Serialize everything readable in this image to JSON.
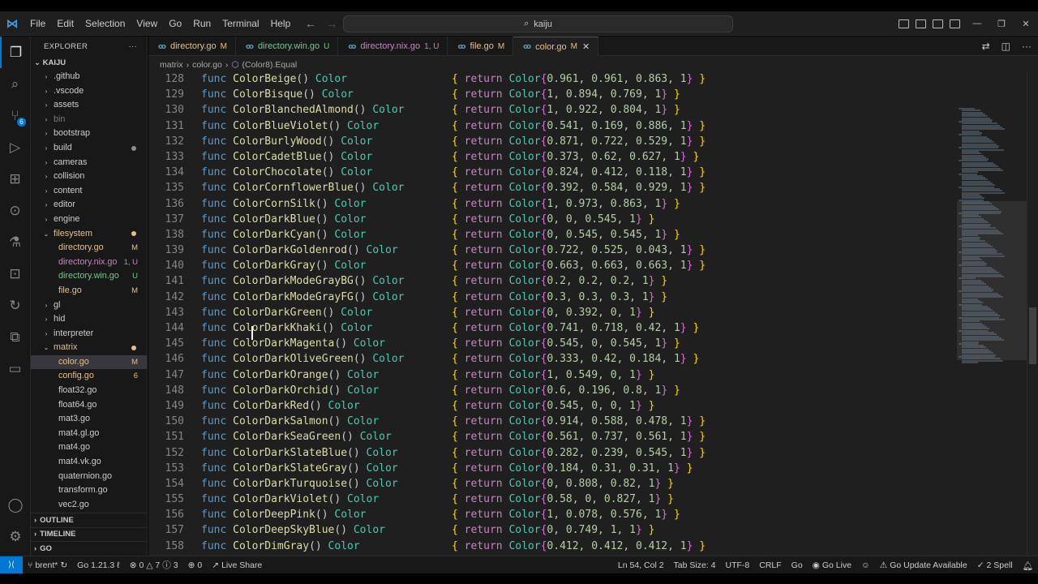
{
  "menu": [
    "File",
    "Edit",
    "Selection",
    "View",
    "Go",
    "Run",
    "Terminal",
    "Help"
  ],
  "search": {
    "text": "kaiju"
  },
  "activity_badge": "6",
  "explorer": {
    "title": "EXPLORER",
    "root": "KAIJU",
    "items": [
      {
        "label": ".github",
        "type": "folder",
        "level": 0,
        "open": false
      },
      {
        "label": ".vscode",
        "type": "folder",
        "level": 0,
        "open": false
      },
      {
        "label": "assets",
        "type": "folder",
        "level": 0,
        "open": false
      },
      {
        "label": "bin",
        "type": "folder",
        "level": 0,
        "open": false,
        "dim": true
      },
      {
        "label": "bootstrap",
        "type": "folder",
        "level": 0,
        "open": false
      },
      {
        "label": "build",
        "type": "folder",
        "level": 0,
        "open": false,
        "dot": "#8c8c8c"
      },
      {
        "label": "cameras",
        "type": "folder",
        "level": 0,
        "open": false
      },
      {
        "label": "collision",
        "type": "folder",
        "level": 0,
        "open": false
      },
      {
        "label": "content",
        "type": "folder",
        "level": 0,
        "open": false
      },
      {
        "label": "editor",
        "type": "folder",
        "level": 0,
        "open": false
      },
      {
        "label": "engine",
        "type": "folder",
        "level": 0,
        "open": false
      },
      {
        "label": "filesystem",
        "type": "folder",
        "level": 0,
        "open": true,
        "color": "#e2c08d",
        "dot": "#e2c08d"
      },
      {
        "label": "directory.go",
        "type": "file",
        "level": 1,
        "color": "#e2c08d",
        "badge": "M"
      },
      {
        "label": "directory.nix.go",
        "type": "file",
        "level": 1,
        "color": "#c586c0",
        "badge": "1, U"
      },
      {
        "label": "directory.win.go",
        "type": "file",
        "level": 1,
        "color": "#73c991",
        "badge": "U"
      },
      {
        "label": "file.go",
        "type": "file",
        "level": 1,
        "color": "#e2c08d",
        "badge": "M"
      },
      {
        "label": "gl",
        "type": "folder",
        "level": 0,
        "open": false
      },
      {
        "label": "hid",
        "type": "folder",
        "level": 0,
        "open": false
      },
      {
        "label": "interpreter",
        "type": "folder",
        "level": 0,
        "open": false
      },
      {
        "label": "matrix",
        "type": "folder",
        "level": 0,
        "open": true,
        "color": "#e2c08d",
        "dot": "#e2c08d"
      },
      {
        "label": "color.go",
        "type": "file",
        "level": 1,
        "color": "#e2c08d",
        "badge": "M",
        "selected": true
      },
      {
        "label": "config.go",
        "type": "file",
        "level": 1,
        "color": "#e2c08d",
        "badge": "6"
      },
      {
        "label": "float32.go",
        "type": "file",
        "level": 1
      },
      {
        "label": "float64.go",
        "type": "file",
        "level": 1
      },
      {
        "label": "mat3.go",
        "type": "file",
        "level": 1
      },
      {
        "label": "mat4.gl.go",
        "type": "file",
        "level": 1
      },
      {
        "label": "mat4.go",
        "type": "file",
        "level": 1
      },
      {
        "label": "mat4.vk.go",
        "type": "file",
        "level": 1
      },
      {
        "label": "quaternion.go",
        "type": "file",
        "level": 1
      },
      {
        "label": "transform.go",
        "type": "file",
        "level": 1
      },
      {
        "label": "vec2.go",
        "type": "file",
        "level": 1
      }
    ],
    "sections": [
      "OUTLINE",
      "TIMELINE",
      "GO"
    ]
  },
  "tabs": [
    {
      "label": "directory.go",
      "badge": "M",
      "color": "#e2c08d"
    },
    {
      "label": "directory.win.go",
      "badge": "U",
      "color": "#73c991"
    },
    {
      "label": "directory.nix.go",
      "badge": "1, U",
      "color": "#c586c0"
    },
    {
      "label": "file.go",
      "badge": "M",
      "color": "#e2c08d"
    },
    {
      "label": "color.go",
      "badge": "M",
      "color": "#e2c08d",
      "active": true
    }
  ],
  "breadcrumb": [
    "matrix",
    "color.go",
    "(Color8).Equal"
  ],
  "code_lines": [
    {
      "n": "128",
      "name": "ColorBeige",
      "vals": "0.961, 0.961, 0.863, 1"
    },
    {
      "n": "129",
      "name": "ColorBisque",
      "vals": "1, 0.894, 0.769, 1"
    },
    {
      "n": "130",
      "name": "ColorBlanchedAlmond",
      "vals": "1, 0.922, 0.804, 1"
    },
    {
      "n": "131",
      "name": "ColorBlueViolet",
      "vals": "0.541, 0.169, 0.886, 1"
    },
    {
      "n": "132",
      "name": "ColorBurlyWood",
      "vals": "0.871, 0.722, 0.529, 1"
    },
    {
      "n": "133",
      "name": "ColorCadetBlue",
      "vals": "0.373, 0.62, 0.627, 1"
    },
    {
      "n": "134",
      "name": "ColorChocolate",
      "vals": "0.824, 0.412, 0.118, 1"
    },
    {
      "n": "135",
      "name": "ColorCornflowerBlue",
      "vals": "0.392, 0.584, 0.929, 1"
    },
    {
      "n": "136",
      "name": "ColorCornSilk",
      "vals": "1, 0.973, 0.863, 1"
    },
    {
      "n": "137",
      "name": "ColorDarkBlue",
      "vals": "0, 0, 0.545, 1"
    },
    {
      "n": "138",
      "name": "ColorDarkCyan",
      "vals": "0, 0.545, 0.545, 1"
    },
    {
      "n": "139",
      "name": "ColorDarkGoldenrod",
      "vals": "0.722, 0.525, 0.043, 1"
    },
    {
      "n": "140",
      "name": "ColorDarkGray",
      "vals": "0.663, 0.663, 0.663, 1"
    },
    {
      "n": "141",
      "name": "ColorDarkModeGrayBG",
      "vals": "0.2, 0.2, 0.2, 1"
    },
    {
      "n": "142",
      "name": "ColorDarkModeGrayFG",
      "vals": "0.3, 0.3, 0.3, 1"
    },
    {
      "n": "143",
      "name": "ColorDarkGreen",
      "vals": "0, 0.392, 0, 1"
    },
    {
      "n": "144",
      "name": "ColorDarkKhaki",
      "vals": "0.741, 0.718, 0.42, 1"
    },
    {
      "n": "145",
      "name": "ColorDarkMagenta",
      "vals": "0.545, 0, 0.545, 1"
    },
    {
      "n": "146",
      "name": "ColorDarkOliveGreen",
      "vals": "0.333, 0.42, 0.184, 1"
    },
    {
      "n": "147",
      "name": "ColorDarkOrange",
      "vals": "1, 0.549, 0, 1"
    },
    {
      "n": "148",
      "name": "ColorDarkOrchid",
      "vals": "0.6, 0.196, 0.8, 1"
    },
    {
      "n": "149",
      "name": "ColorDarkRed",
      "vals": "0.545, 0, 0, 1"
    },
    {
      "n": "150",
      "name": "ColorDarkSalmon",
      "vals": "0.914, 0.588, 0.478, 1"
    },
    {
      "n": "151",
      "name": "ColorDarkSeaGreen",
      "vals": "0.561, 0.737, 0.561, 1"
    },
    {
      "n": "152",
      "name": "ColorDarkSlateBlue",
      "vals": "0.282, 0.239, 0.545, 1"
    },
    {
      "n": "153",
      "name": "ColorDarkSlateGray",
      "vals": "0.184, 0.31, 0.31, 1"
    },
    {
      "n": "154",
      "name": "ColorDarkTurquoise",
      "vals": "0, 0.808, 0.82, 1"
    },
    {
      "n": "155",
      "name": "ColorDarkViolet",
      "vals": "0.58, 0, 0.827, 1"
    },
    {
      "n": "156",
      "name": "ColorDeepPink",
      "vals": "1, 0.078, 0.576, 1"
    },
    {
      "n": "157",
      "name": "ColorDeepSkyBlue",
      "vals": "0, 0.749, 1, 1"
    },
    {
      "n": "158",
      "name": "ColorDimGray",
      "vals": "0.412, 0.412, 0.412, 1"
    }
  ],
  "status": {
    "branch": "brent*",
    "go_version": "Go 1.21.3",
    "errors": "0",
    "warnings": "7",
    "infos": "3",
    "ports": "0",
    "live_share": "Live Share",
    "position": "Ln 54, Col 2",
    "tab_size": "Tab Size: 4",
    "encoding": "UTF-8",
    "eol": "CRLF",
    "language": "Go",
    "go_live": "Go Live",
    "go_update": "Go Update Available",
    "spell": "2 Spell"
  },
  "colors": {
    "accent": "#0078d4",
    "modified": "#e2c08d",
    "untracked": "#73c991",
    "conflict": "#c586c0"
  }
}
